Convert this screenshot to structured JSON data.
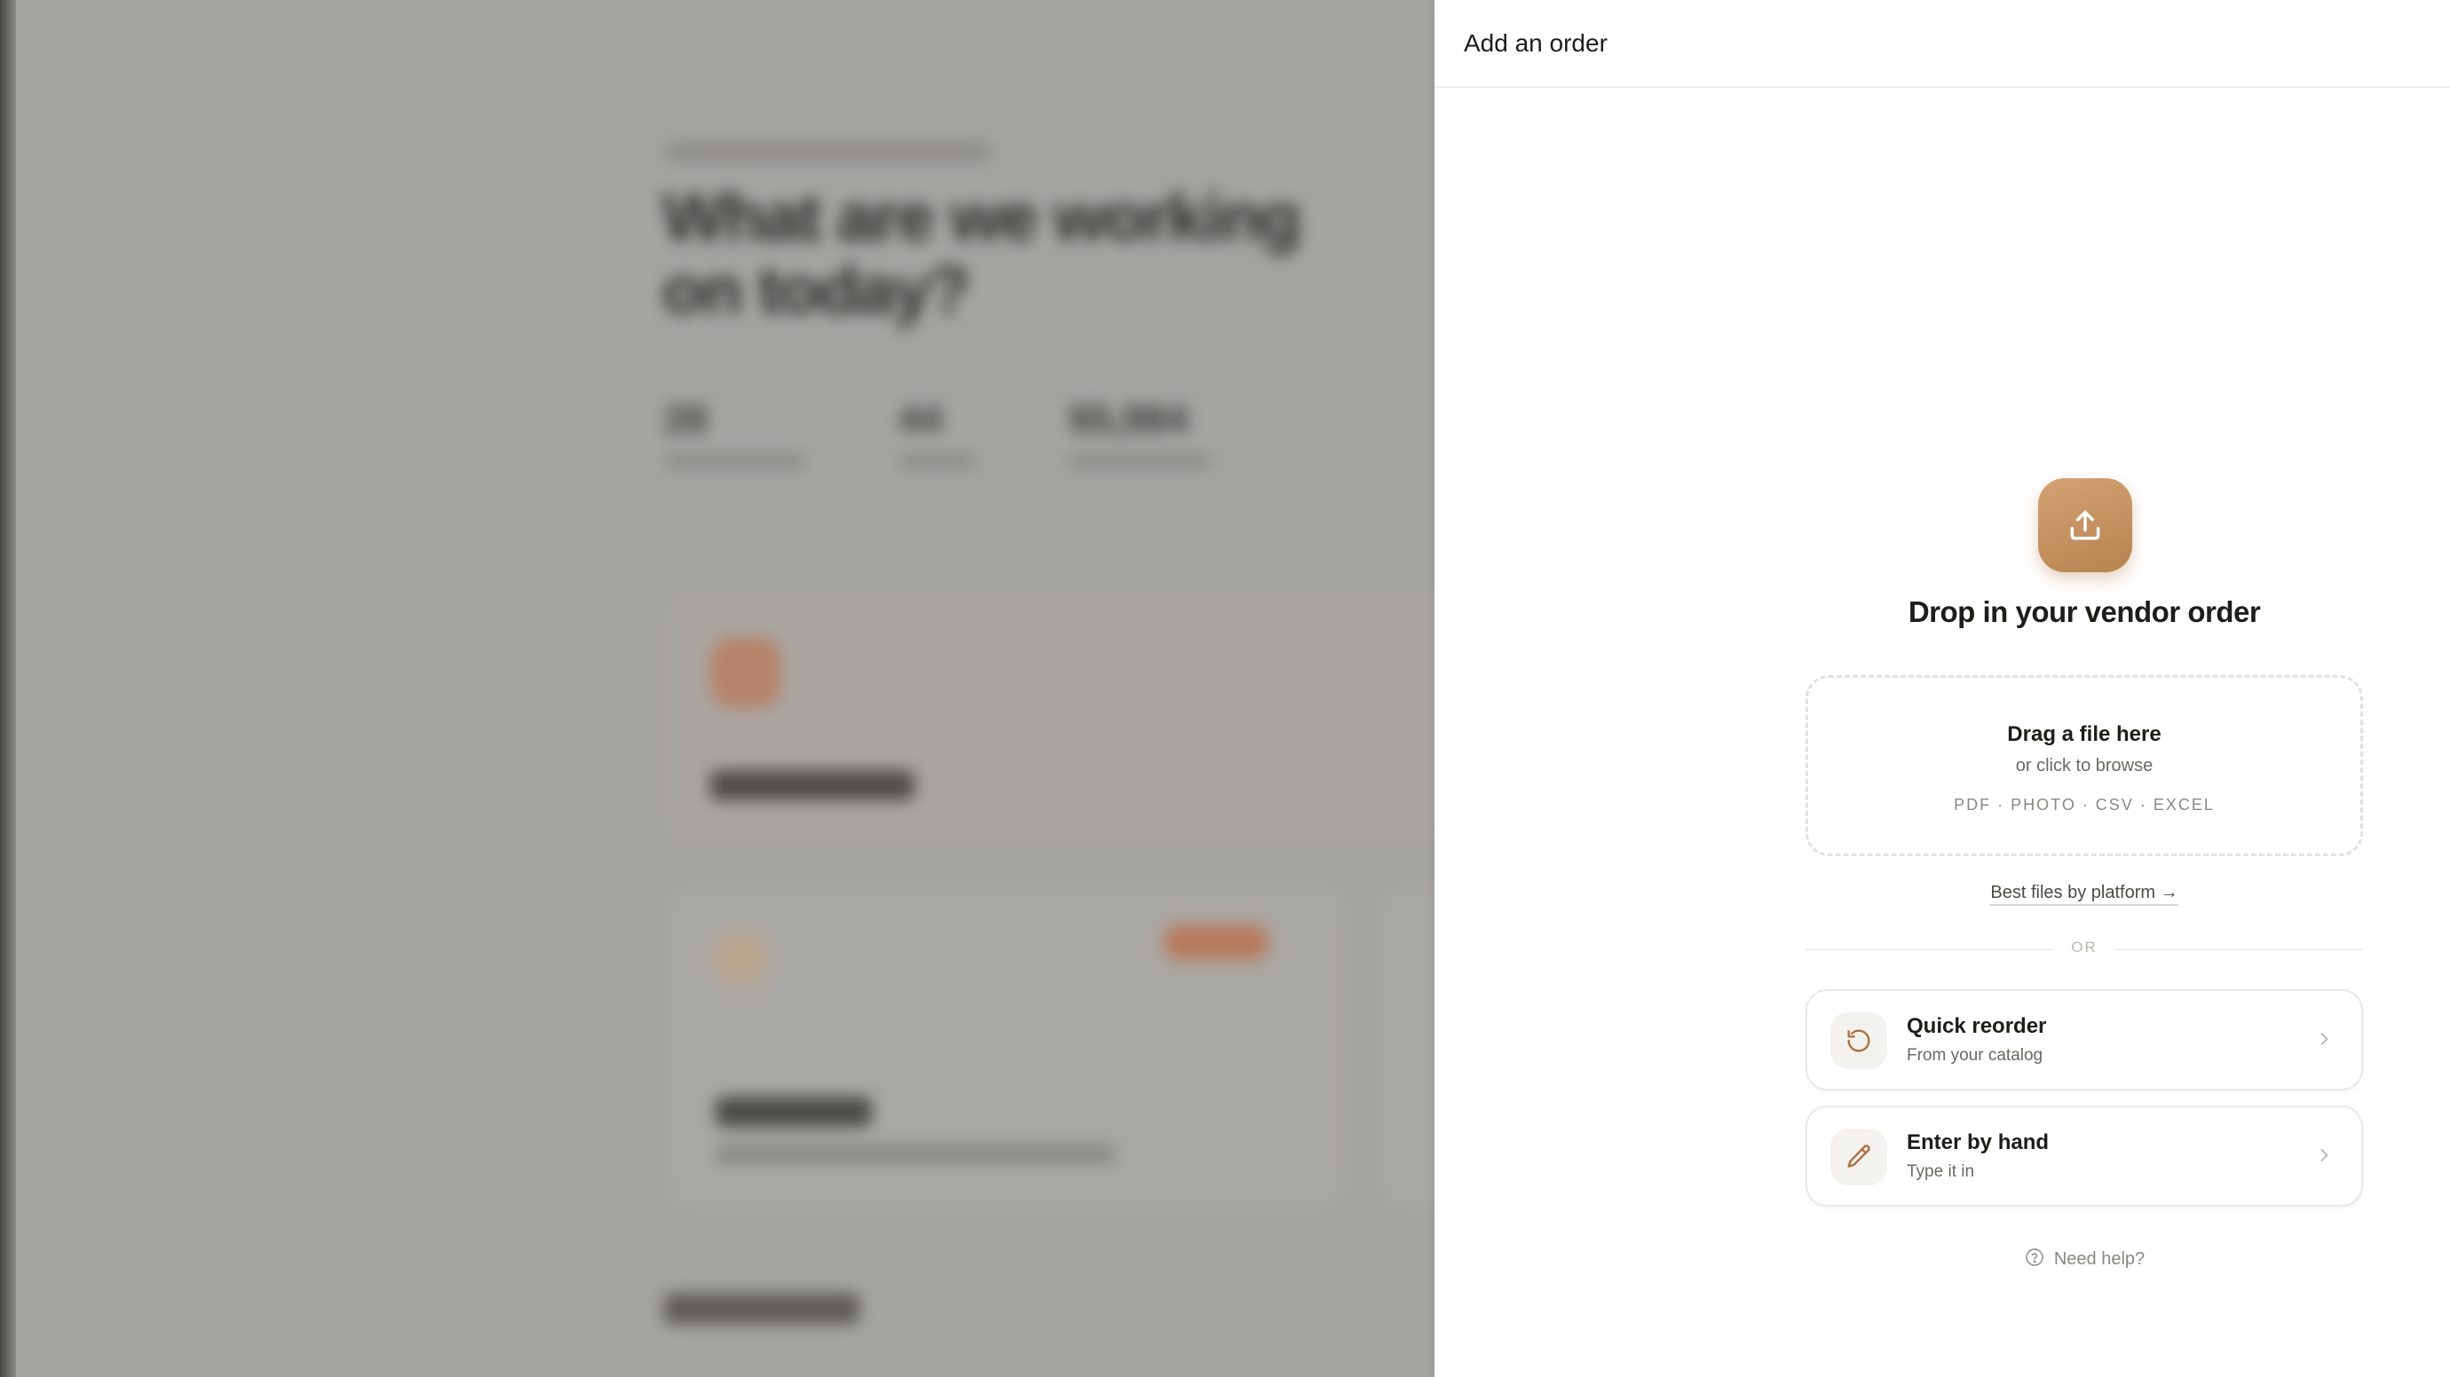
{
  "background": {
    "title": "What are we working on today?",
    "stats": [
      "28",
      "44",
      "$5,984"
    ]
  },
  "drawer": {
    "title": "Add an order",
    "upload_icon": "upload-icon",
    "heading": "Drop in your vendor order",
    "dropzone": {
      "title": "Drag a file here",
      "subtitle": "or click to browse",
      "formats": "PDF · PHOTO · CSV · EXCEL"
    },
    "best_files_link": "Best files by platform →",
    "divider_label": "OR",
    "options": [
      {
        "title": "Quick reorder",
        "subtitle": "From your catalog",
        "icon": "reorder-icon"
      },
      {
        "title": "Enter by hand",
        "subtitle": "Type it in",
        "icon": "pencil-icon"
      }
    ],
    "help": "Need help?"
  },
  "colors": {
    "accent": "#c4915f",
    "backdrop": "#a5a4a1"
  }
}
